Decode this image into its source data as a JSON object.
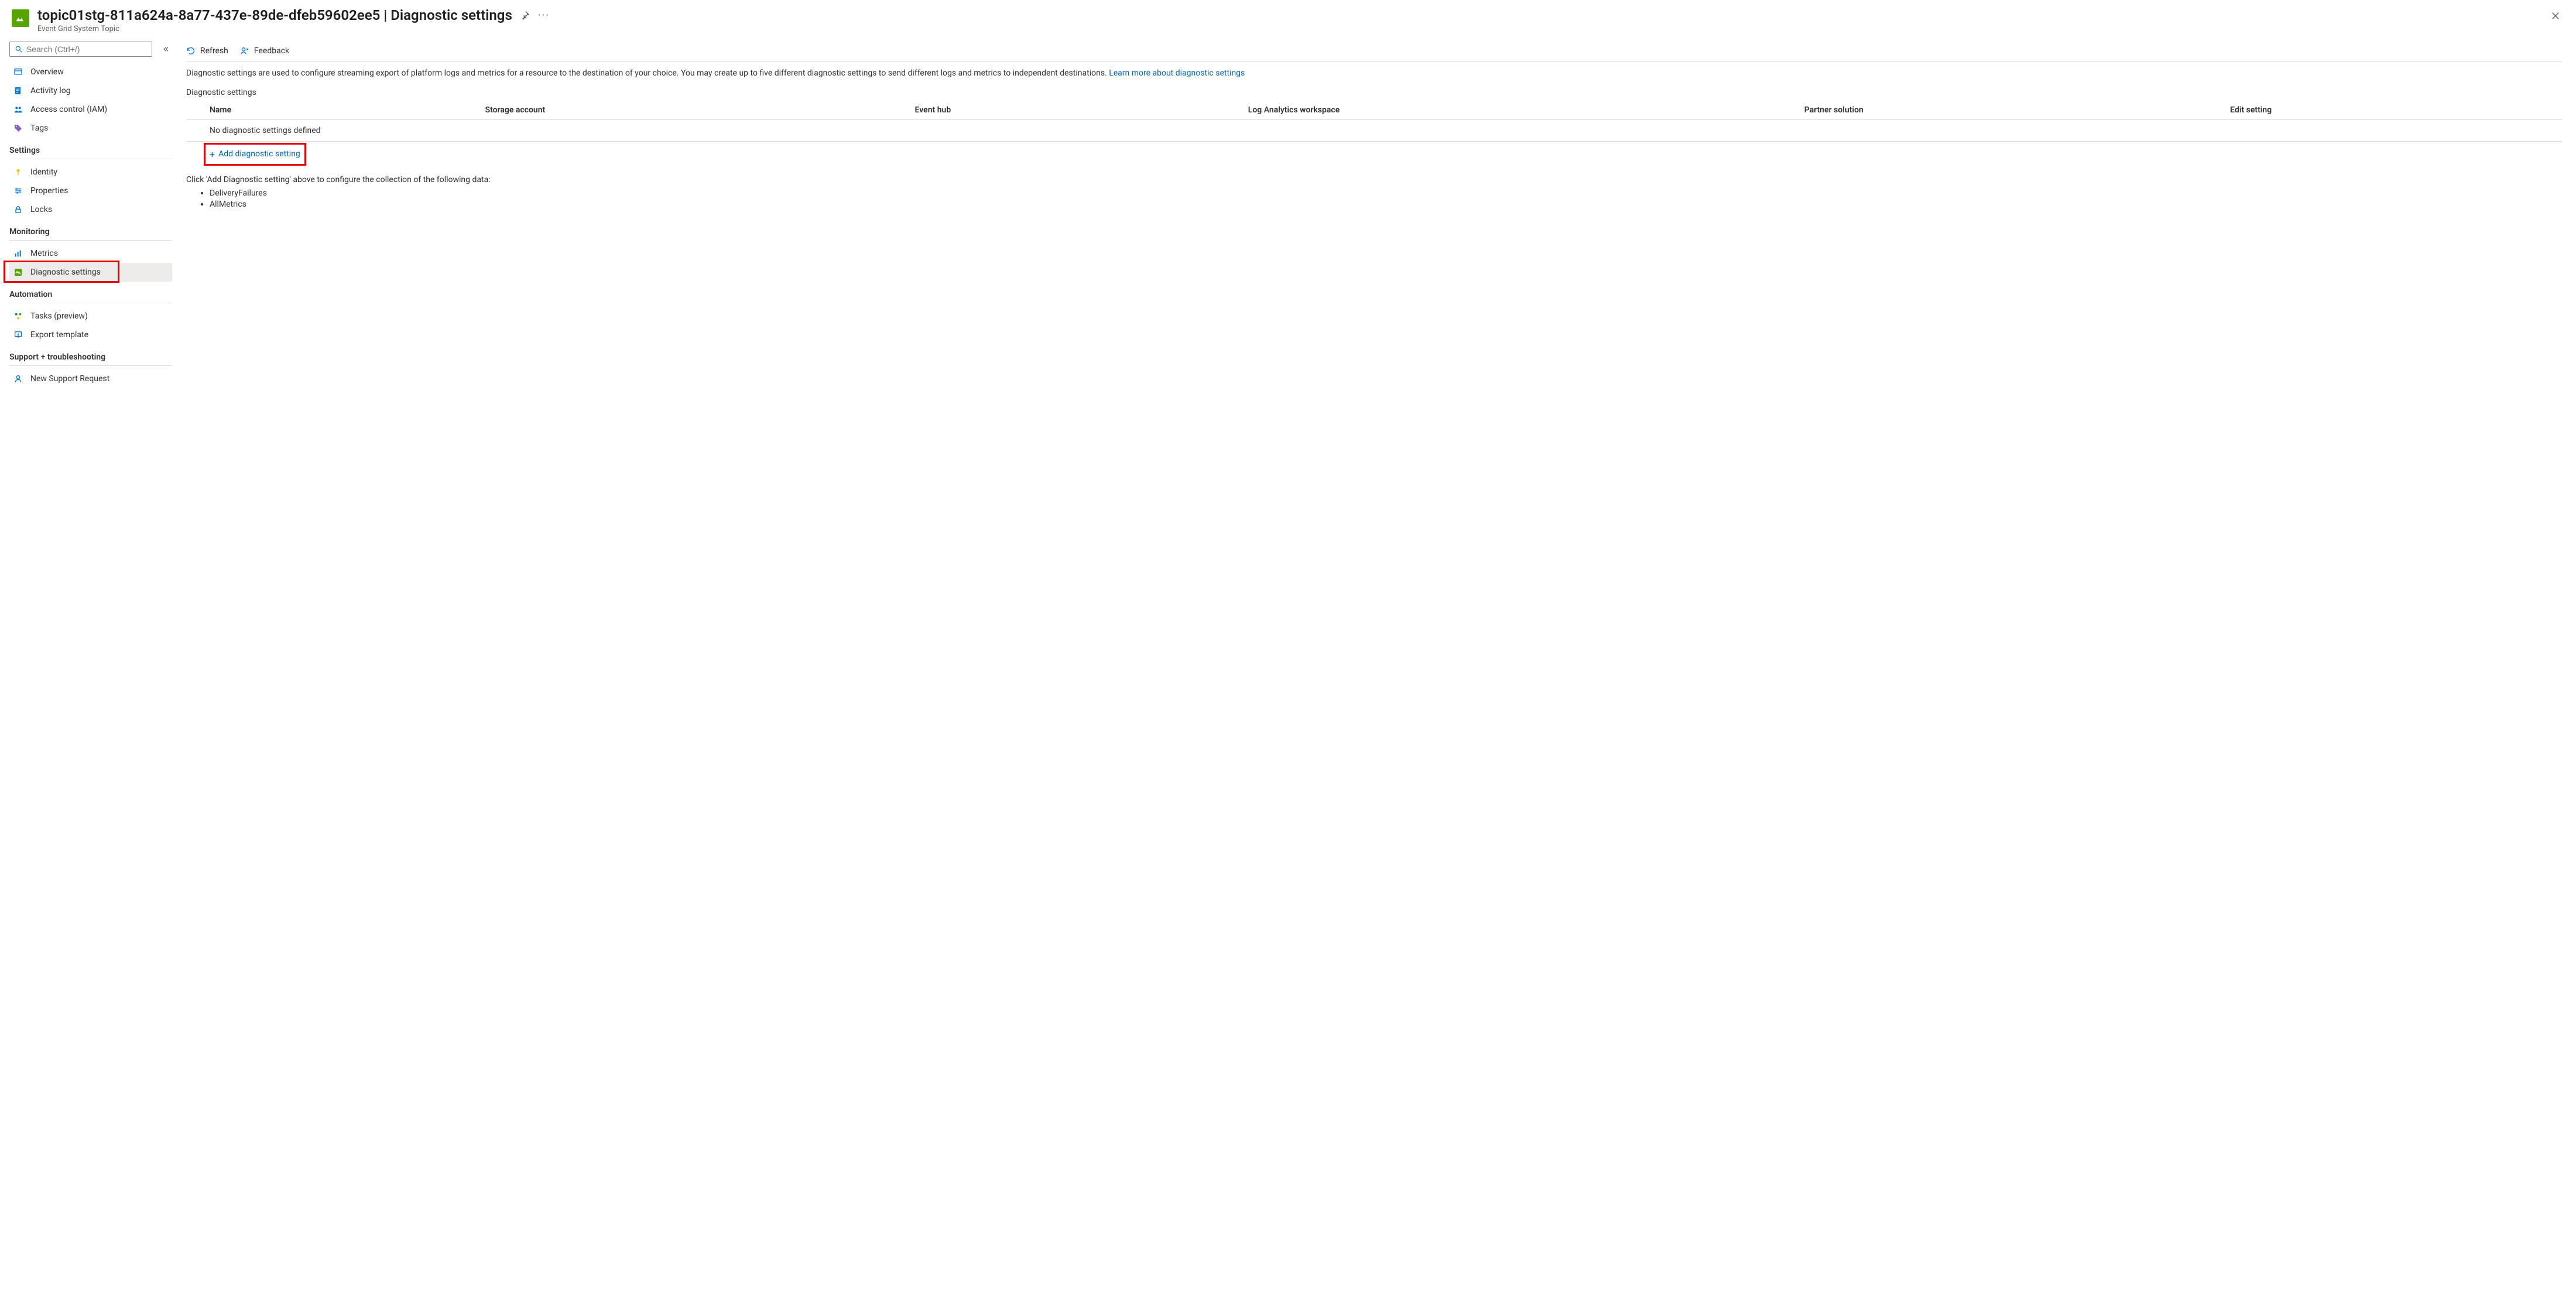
{
  "header": {
    "title": "topic01stg-811a624a-8a77-437e-89de-dfeb59602ee5 | Diagnostic settings",
    "subtitle": "Event Grid System Topic"
  },
  "sidebar": {
    "search_placeholder": "Search (Ctrl+/)",
    "top": [
      {
        "icon": "overview",
        "label": "Overview"
      },
      {
        "icon": "activity",
        "label": "Activity log"
      },
      {
        "icon": "iam",
        "label": "Access control (IAM)"
      },
      {
        "icon": "tags",
        "label": "Tags"
      }
    ],
    "groups": [
      {
        "title": "Settings",
        "items": [
          {
            "icon": "identity",
            "label": "Identity"
          },
          {
            "icon": "properties",
            "label": "Properties"
          },
          {
            "icon": "locks",
            "label": "Locks"
          }
        ]
      },
      {
        "title": "Monitoring",
        "items": [
          {
            "icon": "metrics",
            "label": "Metrics"
          },
          {
            "icon": "diagnostic",
            "label": "Diagnostic settings",
            "selected": true
          }
        ]
      },
      {
        "title": "Automation",
        "items": [
          {
            "icon": "tasks",
            "label": "Tasks (preview)"
          },
          {
            "icon": "export",
            "label": "Export template"
          }
        ]
      },
      {
        "title": "Support + troubleshooting",
        "items": [
          {
            "icon": "support",
            "label": "New Support Request"
          }
        ]
      }
    ]
  },
  "toolbar": {
    "refresh": "Refresh",
    "feedback": "Feedback"
  },
  "intro": {
    "text1": "Diagnostic settings are used to configure streaming export of platform logs and metrics for a resource to the destination of your choice. You may create up to five different diagnostic settings to send different logs and metrics to independent destinations. ",
    "link": "Learn more about diagnostic settings"
  },
  "section_label": "Diagnostic settings",
  "table": {
    "headers": [
      "Name",
      "Storage account",
      "Event hub",
      "Log Analytics workspace",
      "Partner solution",
      "Edit setting"
    ],
    "empty_row": "No diagnostic settings defined",
    "add_label": "Add diagnostic setting"
  },
  "instruction": "Click 'Add Diagnostic setting' above to configure the collection of the following data:",
  "bullets": [
    "DeliveryFailures",
    "AllMetrics"
  ]
}
